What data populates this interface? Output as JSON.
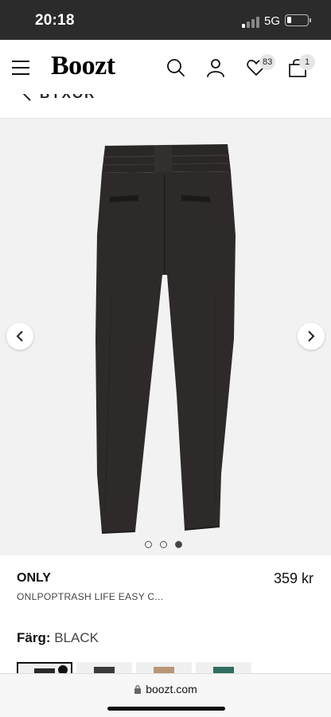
{
  "status_bar": {
    "time": "20:18",
    "network": "5G"
  },
  "header": {
    "logo": "Boozt",
    "wishlist_count": "83",
    "cart_count": "1",
    "icons": [
      "menu-icon",
      "search-icon",
      "account-icon",
      "heart-icon",
      "shopping-bag-icon"
    ]
  },
  "back": {
    "label": "BYXOR",
    "icon": "chevron-left-icon"
  },
  "gallery": {
    "image_count": 3,
    "active_index": 3,
    "prev_icon": "chevron-left-icon",
    "next_icon": "chevron-right-icon",
    "background": "#f2f2f2"
  },
  "product": {
    "brand": "ONLY",
    "price": "359 kr",
    "name": "ONLPOPTRASH LIFE EASY C...",
    "color_label": "Färg:",
    "color_value": "BLACK"
  },
  "swatch_colors": [
    "#2a2a2a",
    "#3a3a3a",
    "#b89678",
    "#2f6e60"
  ],
  "browser": {
    "url": "boozt.com",
    "icon": "lock-icon"
  },
  "colors": {
    "status_bar": "#2b2b2b",
    "pants": "#2d2a29",
    "badge": "#e6e6e6"
  }
}
